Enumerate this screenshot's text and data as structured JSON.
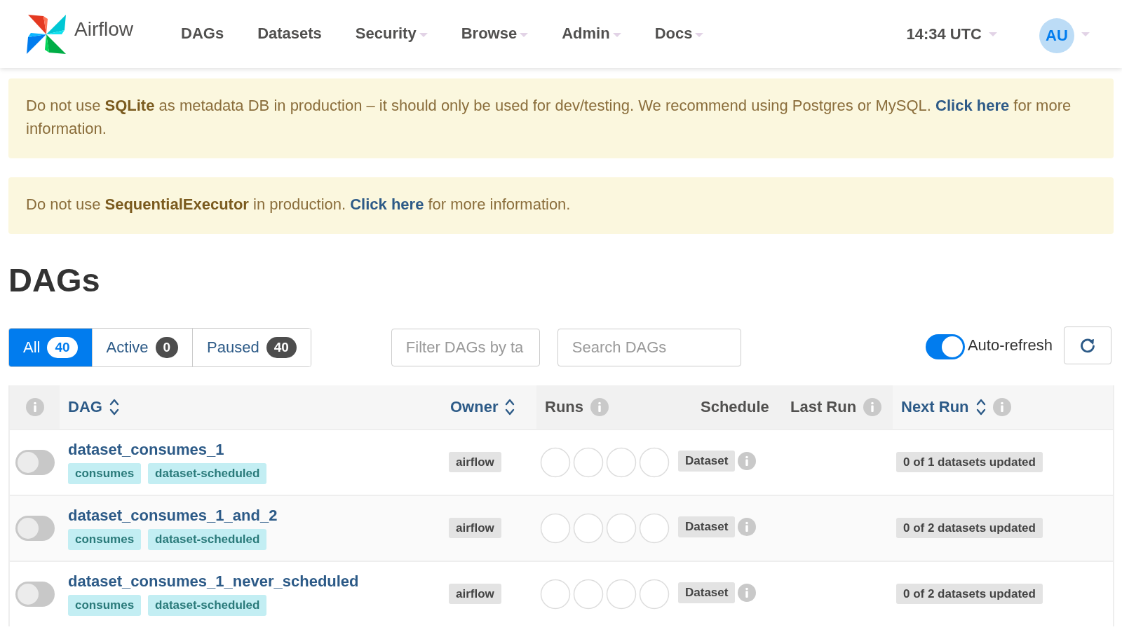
{
  "brand": {
    "name": "Airflow"
  },
  "nav": [
    {
      "label": "DAGs",
      "dropdown": false
    },
    {
      "label": "Datasets",
      "dropdown": false
    },
    {
      "label": "Security",
      "dropdown": true
    },
    {
      "label": "Browse",
      "dropdown": true
    },
    {
      "label": "Admin",
      "dropdown": true
    },
    {
      "label": "Docs",
      "dropdown": true
    }
  ],
  "clock": {
    "label": "14:34 UTC"
  },
  "user": {
    "initials": "AU"
  },
  "alerts": [
    {
      "before": "Do not use **SQLite** as metadata DB in production – it should only be used for dev/testing. We recommend using Postgres or MySQL. ",
      "link": "Click here",
      "after": " for more information."
    },
    {
      "before": "Do not use **SequentialExecutor** in production. ",
      "link": "Click here",
      "after": " for more information."
    }
  ],
  "heading": "DAGs",
  "status_tabs": [
    {
      "label": "All",
      "count": "40",
      "selected": true
    },
    {
      "label": "Active",
      "count": "0",
      "selected": false
    },
    {
      "label": "Paused",
      "count": "40",
      "selected": false
    }
  ],
  "tag_filter": {
    "placeholder": "Filter DAGs by ta"
  },
  "search": {
    "placeholder": "Search DAGs"
  },
  "auto_refresh": {
    "label": "Auto-refresh",
    "on": true
  },
  "table": {
    "columns": [
      {
        "label": "DAG",
        "sortable": true,
        "info": false
      },
      {
        "label": "Owner",
        "sortable": true,
        "info": false
      },
      {
        "label": "Runs",
        "sortable": false,
        "info": true
      },
      {
        "label": "Schedule",
        "sortable": false,
        "info": false
      },
      {
        "label": "Last Run",
        "sortable": false,
        "info": true
      },
      {
        "label": "Next Run",
        "sortable": true,
        "info": true
      }
    ],
    "rows": [
      {
        "active": false,
        "dag": "dataset_consumes_1",
        "tags": [
          "consumes",
          "dataset-scheduled"
        ],
        "owner": "airflow",
        "schedule": "Dataset",
        "next_run": "0 of 1 datasets updated"
      },
      {
        "active": false,
        "dag": "dataset_consumes_1_and_2",
        "tags": [
          "consumes",
          "dataset-scheduled"
        ],
        "owner": "airflow",
        "schedule": "Dataset",
        "next_run": "0 of 2 datasets updated"
      },
      {
        "active": false,
        "dag": "dataset_consumes_1_never_scheduled",
        "tags": [
          "consumes",
          "dataset-scheduled"
        ],
        "owner": "airflow",
        "schedule": "Dataset",
        "next_run": "0 of 2 datasets updated"
      }
    ]
  }
}
